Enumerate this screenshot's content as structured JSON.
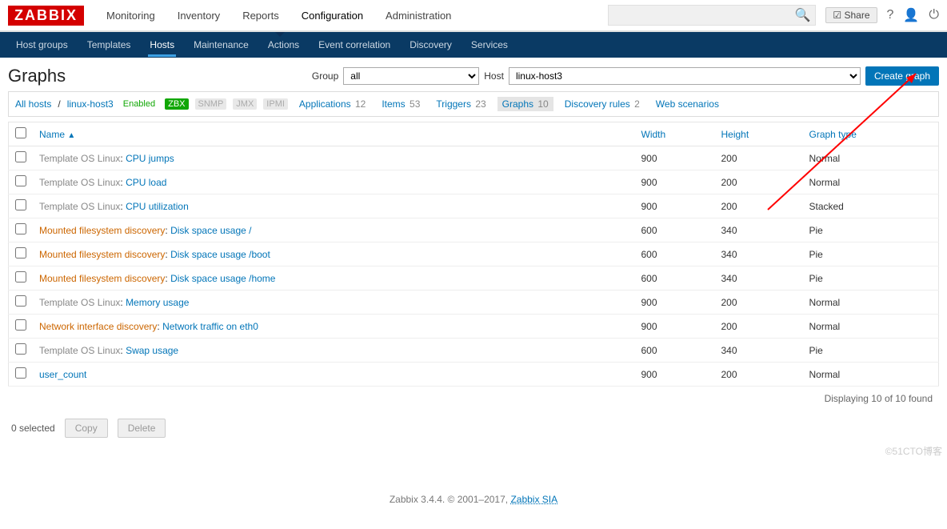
{
  "brand": "ZABBIX",
  "mainNav": {
    "items": [
      "Monitoring",
      "Inventory",
      "Reports",
      "Configuration",
      "Administration"
    ],
    "active": "Configuration"
  },
  "share": "Share",
  "subNav": {
    "items": [
      "Host groups",
      "Templates",
      "Hosts",
      "Maintenance",
      "Actions",
      "Event correlation",
      "Discovery",
      "Services"
    ],
    "active": "Hosts"
  },
  "title": "Graphs",
  "filter": {
    "groupLabel": "Group",
    "group": "all",
    "hostLabel": "Host",
    "host": "linux-host3"
  },
  "createBtn": "Create graph",
  "context": {
    "allHosts": "All hosts",
    "hostName": "linux-host3",
    "enabled": "Enabled",
    "zbx": "ZBX",
    "snmp": "SNMP",
    "jmx": "JMX",
    "ipmi": "IPMI",
    "apps": {
      "label": "Applications",
      "count": "12"
    },
    "items": {
      "label": "Items",
      "count": "53"
    },
    "triggers": {
      "label": "Triggers",
      "count": "23"
    },
    "graphs": {
      "label": "Graphs",
      "count": "10"
    },
    "drules": {
      "label": "Discovery rules",
      "count": "2"
    },
    "web": {
      "label": "Web scenarios",
      "count": ""
    }
  },
  "columns": {
    "name": "Name",
    "width": "Width",
    "height": "Height",
    "type": "Graph type"
  },
  "rows": [
    {
      "prefix": "Template OS Linux",
      "pclass": "tmpl",
      "link": "CPU jumps",
      "w": "900",
      "h": "200",
      "t": "Normal"
    },
    {
      "prefix": "Template OS Linux",
      "pclass": "tmpl",
      "link": "CPU load",
      "w": "900",
      "h": "200",
      "t": "Normal"
    },
    {
      "prefix": "Template OS Linux",
      "pclass": "tmpl",
      "link": "CPU utilization",
      "w": "900",
      "h": "200",
      "t": "Stacked"
    },
    {
      "prefix": "Mounted filesystem discovery",
      "pclass": "disc",
      "link": "Disk space usage /",
      "w": "600",
      "h": "340",
      "t": "Pie"
    },
    {
      "prefix": "Mounted filesystem discovery",
      "pclass": "disc",
      "link": "Disk space usage /boot",
      "w": "600",
      "h": "340",
      "t": "Pie"
    },
    {
      "prefix": "Mounted filesystem discovery",
      "pclass": "disc",
      "link": "Disk space usage /home",
      "w": "600",
      "h": "340",
      "t": "Pie"
    },
    {
      "prefix": "Template OS Linux",
      "pclass": "tmpl",
      "link": "Memory usage",
      "w": "900",
      "h": "200",
      "t": "Normal"
    },
    {
      "prefix": "Network interface discovery",
      "pclass": "disc",
      "link": "Network traffic on eth0",
      "w": "900",
      "h": "200",
      "t": "Normal"
    },
    {
      "prefix": "Template OS Linux",
      "pclass": "tmpl",
      "link": "Swap usage",
      "w": "600",
      "h": "340",
      "t": "Pie"
    },
    {
      "prefix": "",
      "pclass": "",
      "link": "user_count",
      "w": "900",
      "h": "200",
      "t": "Normal"
    }
  ],
  "footerCount": "Displaying 10 of 10 found",
  "selected": "0 selected",
  "copy": "Copy",
  "delete": "Delete",
  "appFooter": "Zabbix 3.4.4. © 2001–2017, ",
  "appFooterLink": "Zabbix SIA",
  "watermark": "©51CTO博客"
}
